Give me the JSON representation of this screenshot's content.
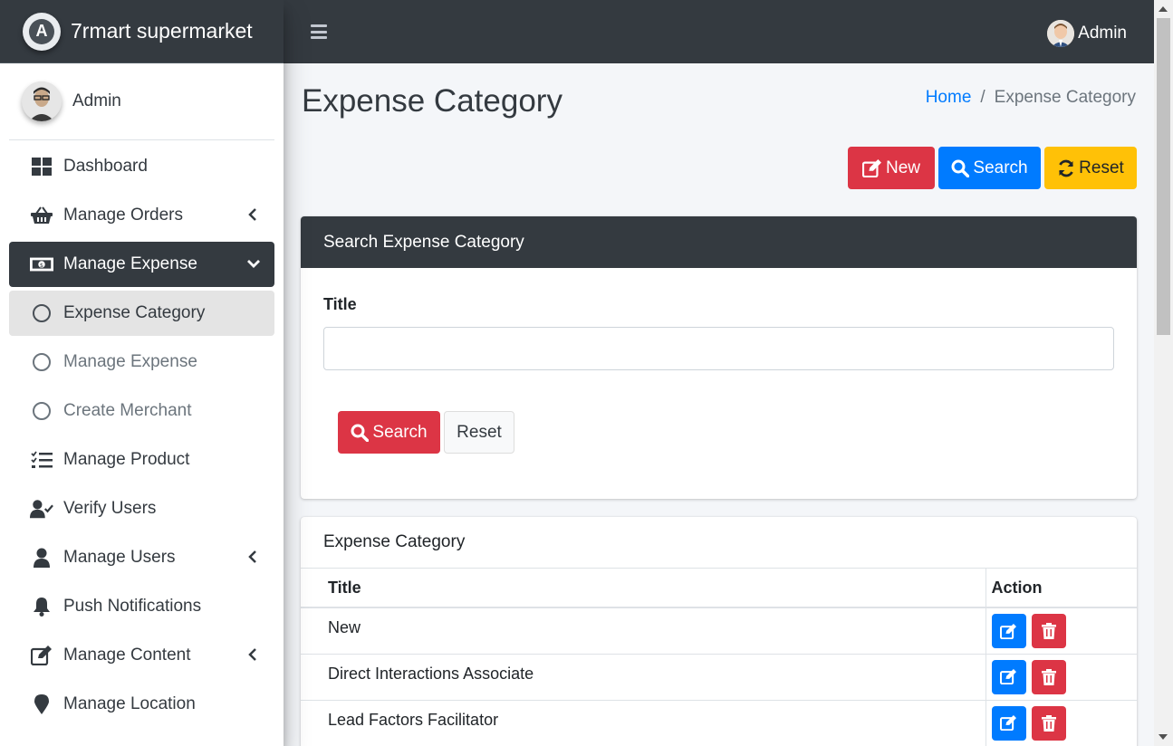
{
  "brand": {
    "name": "7rmart supermarket",
    "logo_letter": "A"
  },
  "topbar": {
    "user_name": "Admin"
  },
  "sidebar": {
    "user_name": "Admin",
    "items": [
      {
        "label": "Dashboard",
        "icon": "dashboard-icon"
      },
      {
        "label": "Manage Orders",
        "icon": "basket-icon"
      },
      {
        "label": "Manage Expense",
        "icon": "money-bill-icon"
      },
      {
        "label": "Expense Category",
        "icon": "circle-icon"
      },
      {
        "label": "Manage Expense",
        "icon": "circle-icon"
      },
      {
        "label": "Create Merchant",
        "icon": "circle-icon"
      },
      {
        "label": "Manage Product",
        "icon": "tasks-icon"
      },
      {
        "label": "Verify Users",
        "icon": "user-check-icon"
      },
      {
        "label": "Manage Users",
        "icon": "user-icon"
      },
      {
        "label": "Push Notifications",
        "icon": "bell-icon"
      },
      {
        "label": "Manage Content",
        "icon": "edit-icon"
      },
      {
        "label": "Manage Location",
        "icon": "map-marker-icon"
      }
    ]
  },
  "page": {
    "title": "Expense Category",
    "breadcrumb": {
      "home": "Home",
      "separator": "/",
      "current": "Expense Category"
    }
  },
  "actions": {
    "new_label": "New",
    "search_label": "Search",
    "reset_label": "Reset"
  },
  "search_card": {
    "header": "Search Expense Category",
    "title_label": "Title",
    "title_value": "",
    "search_label": "Search",
    "reset_label": "Reset"
  },
  "table_card": {
    "title": "Expense Category",
    "columns": {
      "title": "Title",
      "action": "Action"
    },
    "rows": [
      {
        "title": "New"
      },
      {
        "title": "Direct Interactions Associate"
      },
      {
        "title": "Lead Factors Facilitator"
      }
    ]
  },
  "colors": {
    "dark": "#343a40",
    "primary": "#007bff",
    "danger": "#dc3545",
    "warning": "#ffc107",
    "background": "#f4f6f9"
  }
}
